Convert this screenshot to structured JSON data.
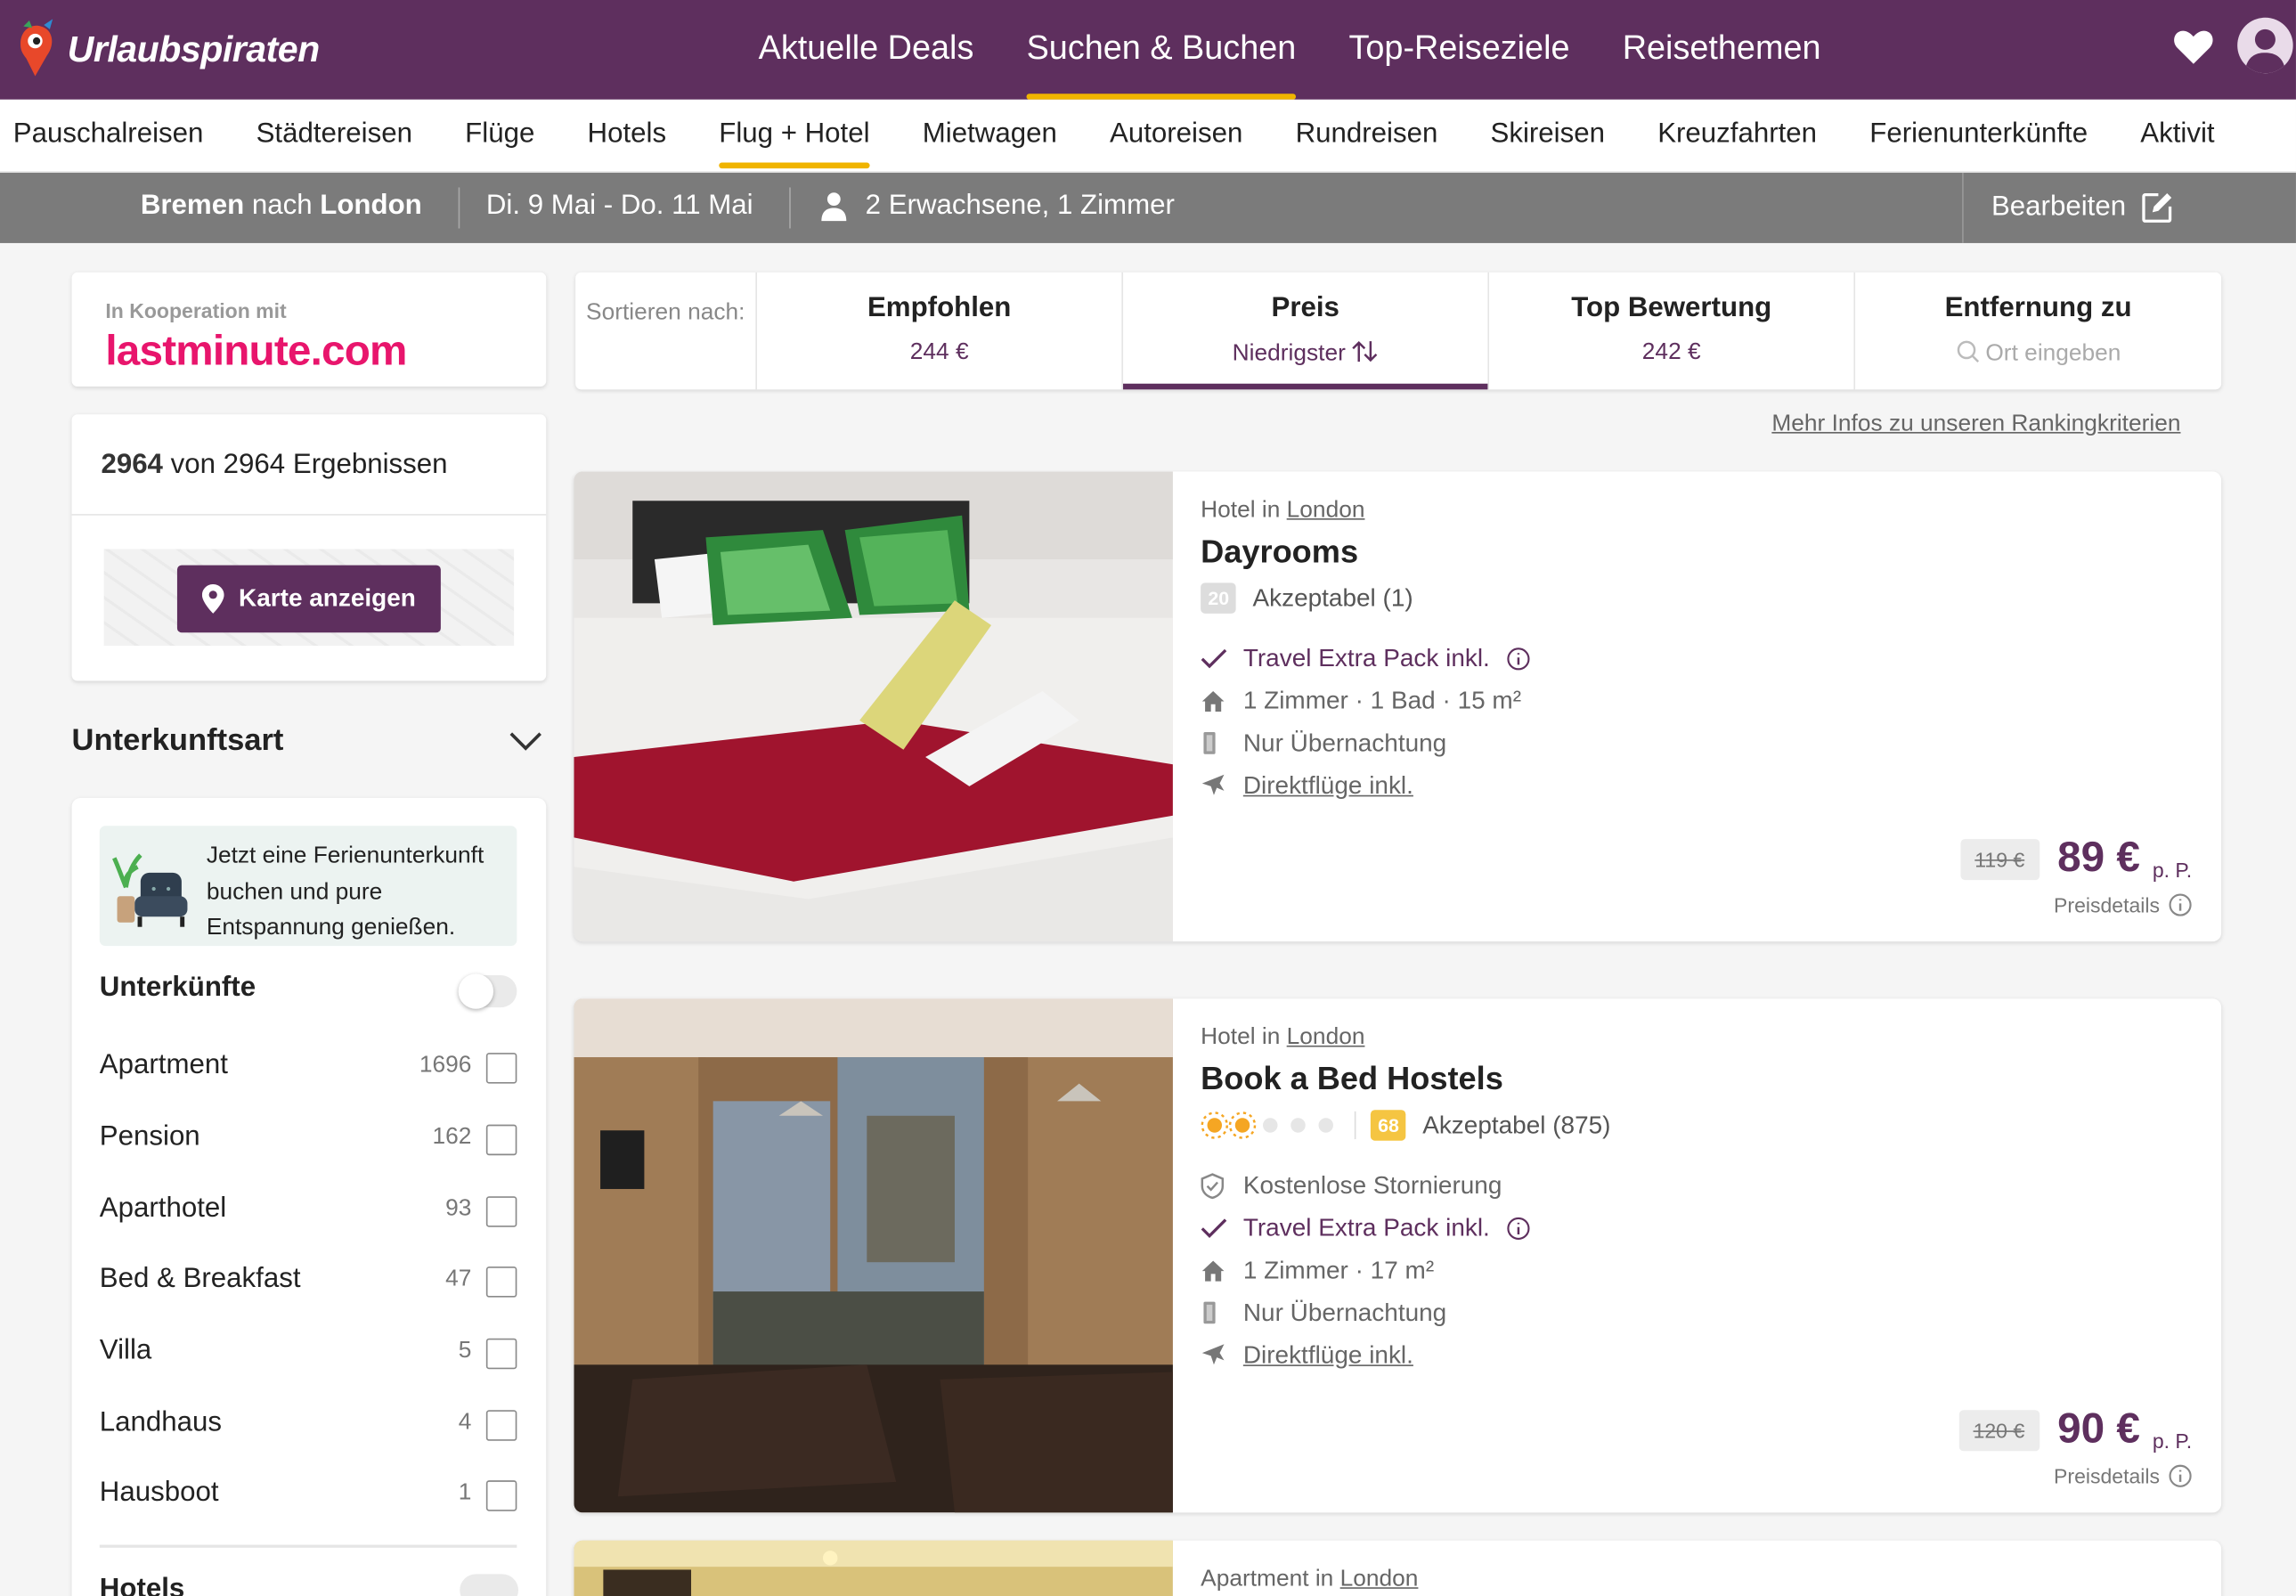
{
  "brand": {
    "name": "Urlaubspiraten"
  },
  "topnav": [
    "Aktuelle Deals",
    "Suchen & Buchen",
    "Top-Reiseziele",
    "Reisethemen"
  ],
  "subnav": [
    "Pauschalreisen",
    "Städtereisen",
    "Flüge",
    "Hotels",
    "Flug + Hotel",
    "Mietwagen",
    "Autoreisen",
    "Rundreisen",
    "Skireisen",
    "Kreuzfahrten",
    "Ferienunterkünfte",
    "Aktivit"
  ],
  "summary": {
    "from": "Bremen",
    "to_word": "nach",
    "to": "London",
    "dates": "Di. 9 Mai - Do. 11 Mai",
    "guests": "2 Erwachsene, 1 Zimmer",
    "edit": "Bearbeiten"
  },
  "coop": {
    "label": "In Kooperation mit",
    "partner": "lastminute.com"
  },
  "results": {
    "shown": "2964",
    "rest": "von 2964 Ergebnissen",
    "map_button": "Karte anzeigen"
  },
  "filter": {
    "title": "Unterkunftsart",
    "promo": "Jetzt eine Ferienunterkunft buchen und pure Entspannung genießen.",
    "group_label": "Unterkünfte",
    "items": [
      {
        "name": "Apartment",
        "count": "1696"
      },
      {
        "name": "Pension",
        "count": "162"
      },
      {
        "name": "Aparthotel",
        "count": "93"
      },
      {
        "name": "Bed & Breakfast",
        "count": "47"
      },
      {
        "name": "Villa",
        "count": "5"
      },
      {
        "name": "Landhaus",
        "count": "4"
      },
      {
        "name": "Hausboot",
        "count": "1"
      }
    ],
    "group2_label": "Hotels"
  },
  "sort": {
    "label": "Sortieren nach:",
    "options": [
      {
        "title": "Empfohlen",
        "sub": "244 €"
      },
      {
        "title": "Preis",
        "sub": "Niedrigster"
      },
      {
        "title": "Top Bewertung",
        "sub": "242 €"
      },
      {
        "title": "Entfernung zu",
        "sub": "Ort eingeben"
      }
    ],
    "more_info": "Mehr Infos zu unseren Rankingkriterien"
  },
  "listings": [
    {
      "type_prefix": "Hotel in",
      "city": "London",
      "name": "Dayrooms",
      "score": "20",
      "rating_text": "Akzeptabel (1)",
      "features": [
        "Travel Extra Pack inkl.",
        "1 Zimmer · 1 Bad · 15 m²",
        "Nur Übernachtung",
        "Direktflüge inkl."
      ],
      "old_price": "119 €",
      "price": "89 €",
      "per": "p. P.",
      "details": "Preisdetails"
    },
    {
      "type_prefix": "Hotel in",
      "city": "London",
      "name": "Book a Bed Hostels",
      "stars": 2,
      "score": "68",
      "rating_text": "Akzeptabel (875)",
      "features": [
        "Kostenlose Stornierung",
        "Travel Extra Pack inkl.",
        "1 Zimmer · 17 m²",
        "Nur Übernachtung",
        "Direktflüge inkl."
      ],
      "old_price": "120 €",
      "price": "90 €",
      "per": "p. P.",
      "details": "Preisdetails"
    },
    {
      "type_prefix": "Apartment in",
      "city": "London"
    }
  ],
  "colors": {
    "brand": "#5e2f5e",
    "accent": "#f0b400",
    "partner": "#e8156c"
  }
}
